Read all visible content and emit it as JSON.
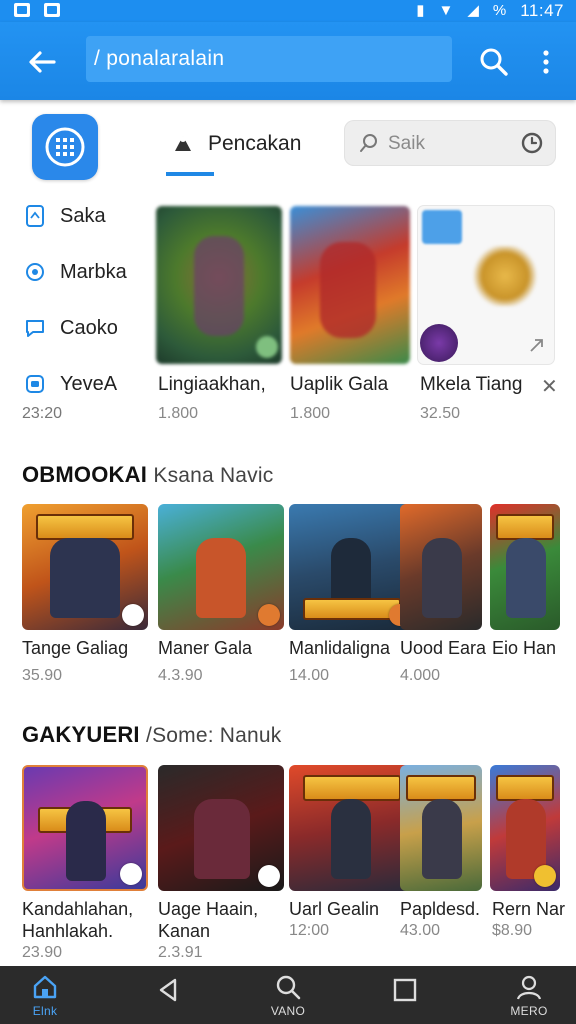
{
  "appbar": {
    "url_text": "/ ponalaralain"
  },
  "status": {
    "time": "11:47",
    "battery": "%"
  },
  "tabs": {
    "active_label": "Pencakan"
  },
  "search": {
    "placeholder": "Saik"
  },
  "side_menu": {
    "items": [
      {
        "label": "Saka",
        "icon": "document-icon"
      },
      {
        "label": "Marbka",
        "icon": "circle-icon"
      },
      {
        "label": "Caoko",
        "icon": "chat-icon"
      },
      {
        "label": "YeveA",
        "icon": "box-icon"
      }
    ],
    "date": "23:20"
  },
  "top_items": [
    {
      "title": "Lingiaakhan,",
      "meta": "1.800"
    },
    {
      "title": "Uaplik Gala",
      "meta": "1.800"
    },
    {
      "title": "Mkela Tiang",
      "meta": "32.50"
    }
  ],
  "section1": {
    "title": "OBMOOKAI",
    "subtitle": "Ksana Navic",
    "cards": [
      {
        "label": "Tange Galiag",
        "meta": "35.90"
      },
      {
        "label": "Maner Gala",
        "meta": "4.3.90"
      },
      {
        "label": "Manlidaligna",
        "meta": "14.00"
      },
      {
        "label": "Uood Eara",
        "meta": "4.000"
      },
      {
        "label": "Eio  Han",
        "meta": ""
      }
    ]
  },
  "section2": {
    "title": "GAKYUERI",
    "subtitle": "/Some: Nanuk",
    "cards": [
      {
        "label": "Kandahlahan, Hanhlakah.",
        "meta": "23.90"
      },
      {
        "label": "Uage Haain, Kanan",
        "meta": "2.3.91"
      },
      {
        "label": "Uarl Gealin",
        "meta": "12:00"
      },
      {
        "label": "Papldesd.",
        "meta": "43.00"
      },
      {
        "label": "Rern Nar",
        "meta": "$8.90"
      }
    ]
  },
  "navbar": {
    "items": [
      {
        "label": "Elnk",
        "icon": "home-icon"
      },
      {
        "label": "",
        "icon": "back-triangle-icon"
      },
      {
        "label": "VANO",
        "icon": "search-icon"
      },
      {
        "label": "",
        "icon": "square-icon"
      },
      {
        "label": "MERO",
        "icon": "user-icon"
      }
    ]
  },
  "colors": {
    "primary": "#1d8ef0",
    "navbar": "#2b2b2b",
    "accent": "#1f88e5"
  }
}
